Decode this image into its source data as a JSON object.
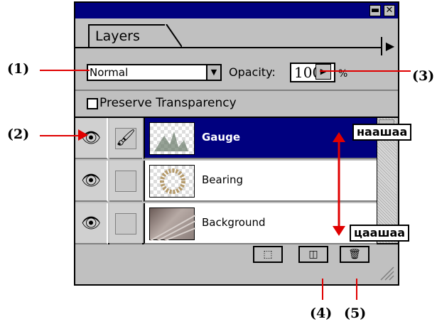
{
  "panel": {
    "tab_label": "Layers",
    "blend_mode": "Normal",
    "opacity_label": "Opacity:",
    "opacity_value": "100",
    "percent_label": "%",
    "preserve_label": "Preserve Transparency",
    "preserve_checked": false
  },
  "layers": [
    {
      "name": "Gauge",
      "selected": true,
      "visible": true,
      "editing": true
    },
    {
      "name": "Bearing",
      "selected": false,
      "visible": true,
      "editing": false
    },
    {
      "name": "Background",
      "selected": false,
      "visible": true,
      "editing": false
    }
  ],
  "annotations": {
    "c1": "(1)",
    "c2": "(2)",
    "c3": "(3)",
    "c4": "(4)",
    "c5": "(5)",
    "up_label": "наашаа",
    "down_label": "цаашаа"
  },
  "colors": {
    "title_bar": "#00007f",
    "selected_row": "#00007f",
    "callout_line": "#e00000"
  }
}
